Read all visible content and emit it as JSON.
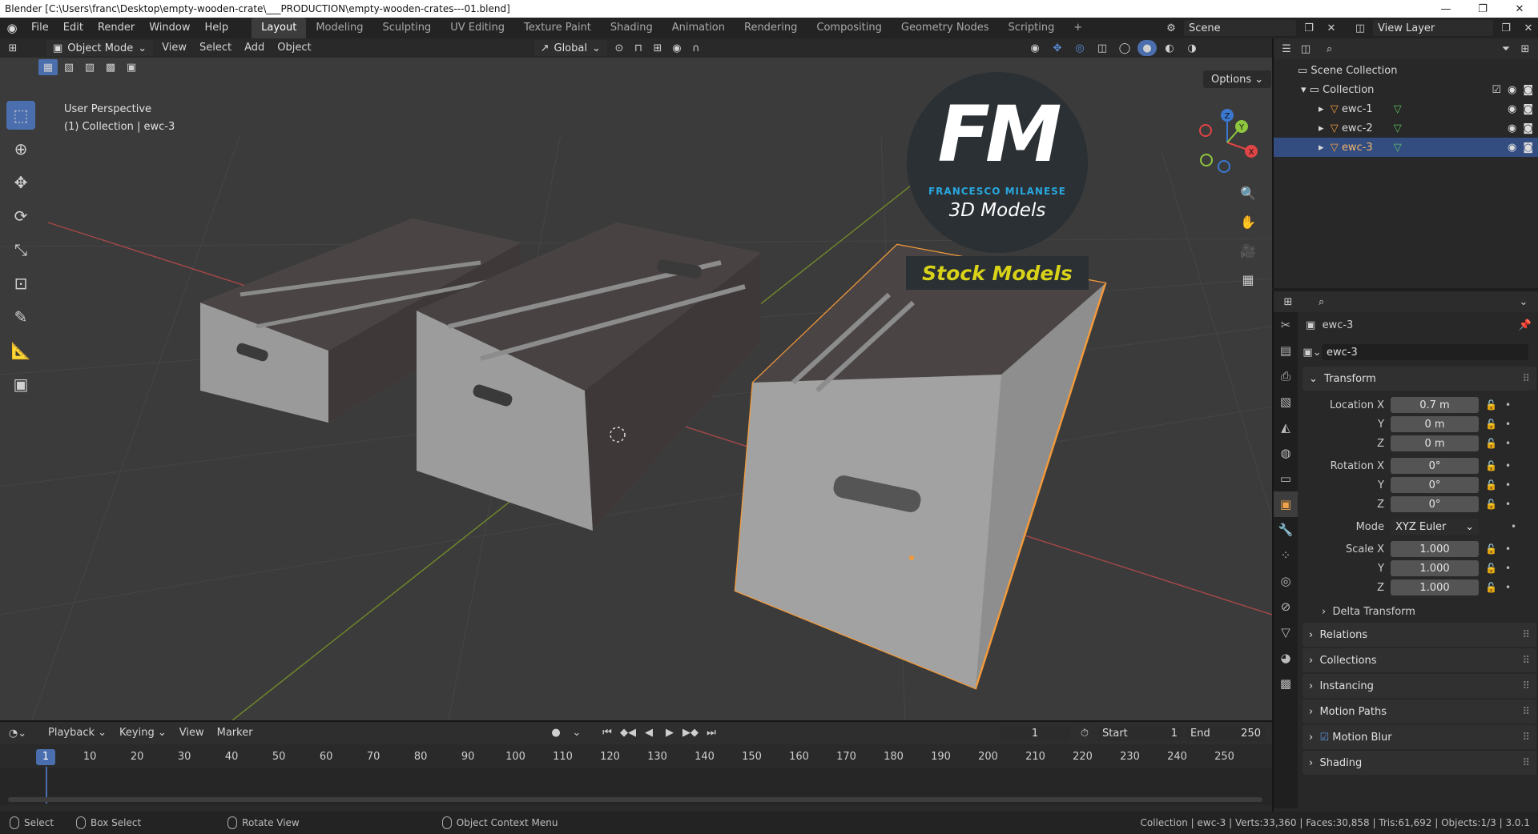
{
  "window": {
    "title": "Blender [C:\\Users\\franc\\Desktop\\empty-wooden-crate\\___PRODUCTION\\empty-wooden-crates---01.blend]"
  },
  "menu": [
    "File",
    "Edit",
    "Render",
    "Window",
    "Help"
  ],
  "workspaces": [
    "Layout",
    "Modeling",
    "Sculpting",
    "UV Editing",
    "Texture Paint",
    "Shading",
    "Animation",
    "Rendering",
    "Compositing",
    "Geometry Nodes",
    "Scripting"
  ],
  "scene": {
    "name": "Scene",
    "view_layer": "View Layer"
  },
  "viewport": {
    "mode": "Object Mode",
    "menus": [
      "View",
      "Select",
      "Add",
      "Object"
    ],
    "transform_orientation": "Global",
    "options_label": "Options",
    "info_line1": "User Perspective",
    "info_line2": "(1) Collection | ewc-3",
    "gizmo_axes": [
      "X",
      "Y",
      "Z"
    ]
  },
  "watermark": {
    "initials": "FM",
    "name": "FRANCESCO MILANESE",
    "subtitle": "3D Models",
    "badge": "Stock Models"
  },
  "outliner": {
    "root": "Scene Collection",
    "collection": "Collection",
    "objects": [
      {
        "name": "ewc-1"
      },
      {
        "name": "ewc-2"
      },
      {
        "name": "ewc-3"
      }
    ]
  },
  "properties": {
    "object_name": "ewc-3",
    "datablock_name": "ewc-3",
    "transform_label": "Transform",
    "location": {
      "label": "Location X",
      "x": "0.7 m",
      "y": "0 m",
      "z": "0 m"
    },
    "rotation": {
      "label": "Rotation X",
      "x": "0°",
      "y": "0°",
      "z": "0°"
    },
    "mode": {
      "label": "Mode",
      "value": "XYZ Euler"
    },
    "scale": {
      "label": "Scale X",
      "x": "1.000",
      "y": "1.000",
      "z": "1.000"
    },
    "axis_labels": {
      "y": "Y",
      "z": "Z"
    },
    "delta_transform": "Delta Transform",
    "panels": [
      "Relations",
      "Collections",
      "Instancing",
      "Motion Paths",
      "Motion Blur",
      "Shading"
    ]
  },
  "timeline": {
    "menus": [
      "Playback",
      "Keying",
      "View",
      "Marker"
    ],
    "current_frame": "1",
    "start_label": "Start",
    "start": "1",
    "end_label": "End",
    "end": "250",
    "ticks": [
      "10",
      "20",
      "30",
      "40",
      "50",
      "60",
      "70",
      "80",
      "90",
      "100",
      "110",
      "120",
      "130",
      "140",
      "150",
      "160",
      "170",
      "180",
      "190",
      "200",
      "210",
      "220",
      "230",
      "240",
      "250"
    ]
  },
  "status": {
    "select": "Select",
    "box_select": "Box Select",
    "rotate": "Rotate View",
    "context_menu": "Object Context Menu",
    "stats": "Collection | ewc-3 | Verts:33,360 | Faces:30,858 | Tris:61,692 | Objects:1/3 | 3.0.1"
  },
  "colors": {
    "accent": "#4b6fae",
    "selected_outline": "#f29a3b",
    "x_axis": "#e04545",
    "y_axis": "#8ec63f",
    "z_axis": "#3a78d0",
    "watermark_badge_text": "#d8d219"
  }
}
